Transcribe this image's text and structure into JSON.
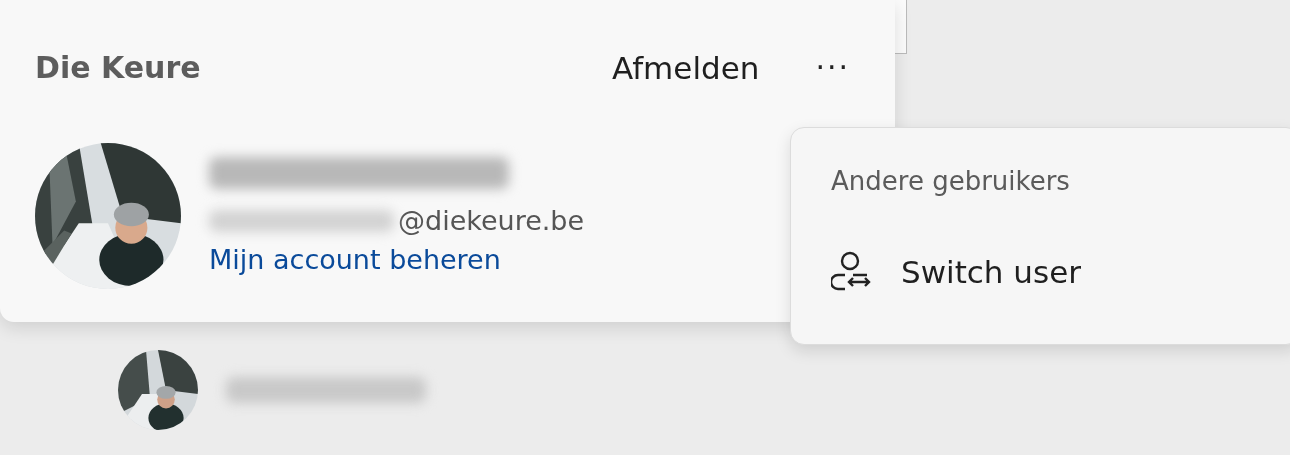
{
  "account_card": {
    "organization": "Die Keure",
    "sign_out": "Afmelden",
    "more": "···",
    "email_domain": "@diekeure.be",
    "manage_link": "Mijn account beheren"
  },
  "menu": {
    "heading": "Andere gebruikers",
    "items": [
      {
        "label": "Switch user",
        "kind": "switch-user"
      }
    ]
  }
}
